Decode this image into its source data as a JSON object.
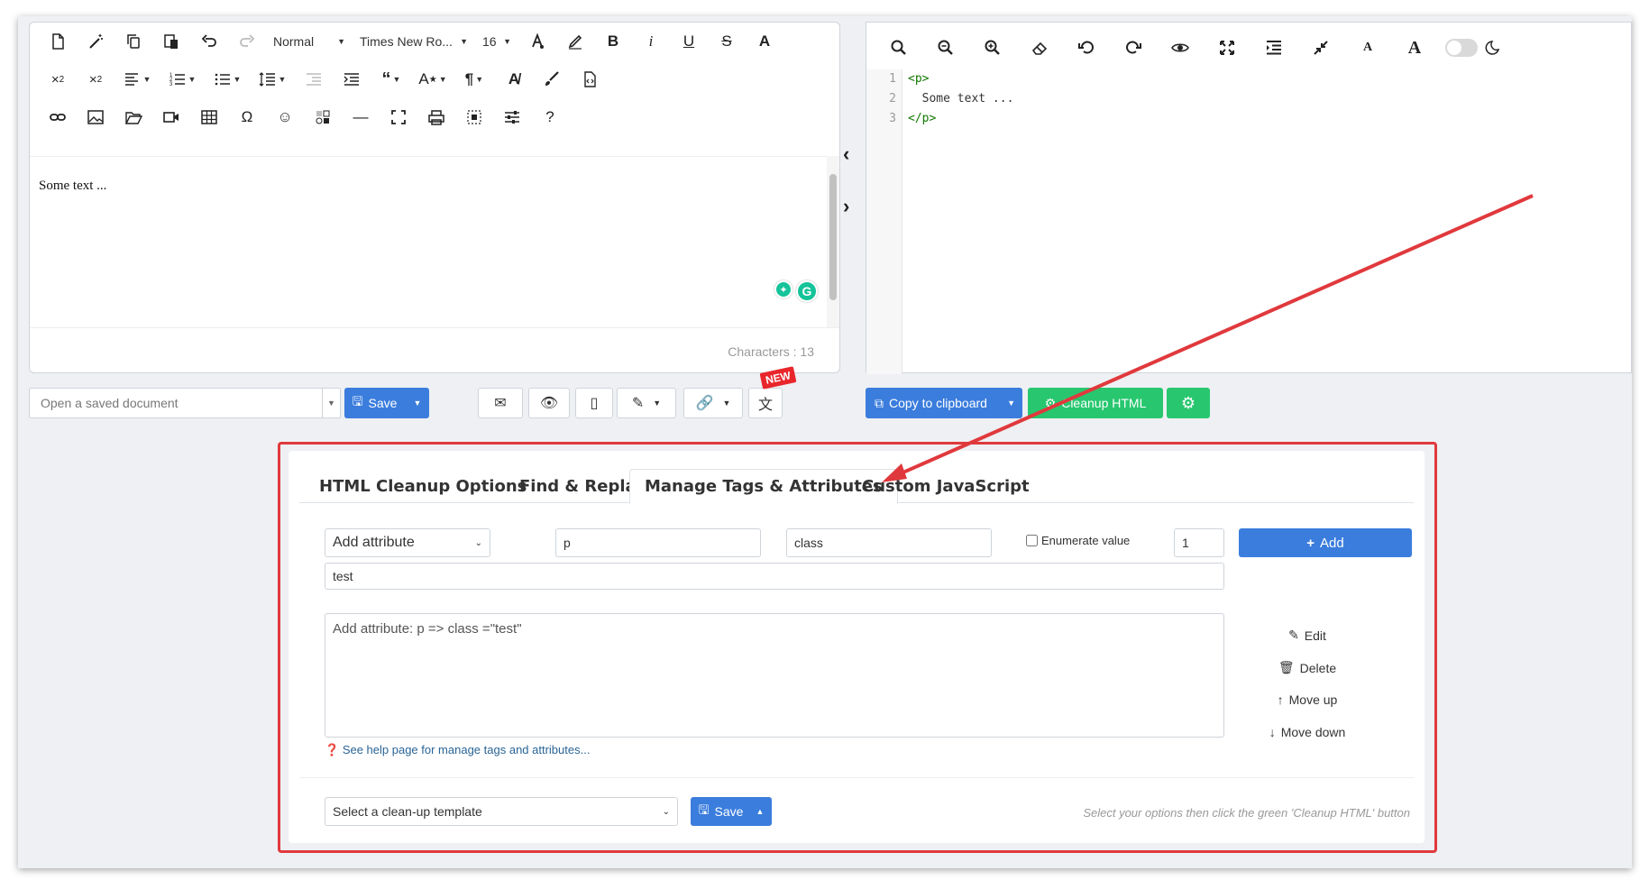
{
  "editor": {
    "toolbar": {
      "format_label": "Normal",
      "font_label": "Times New Ro...",
      "size_label": "16"
    },
    "content_text": "Some text ...",
    "characters_text": "Characters : 13"
  },
  "code_editor": {
    "line_numbers": [
      "1",
      "2",
      "3"
    ],
    "line1_tag": "<p>",
    "line2_text": "  Some text ...",
    "line3_tag": "</p>"
  },
  "action_bar": {
    "open_doc_placeholder": "Open a saved document",
    "save_label": "Save",
    "new_badge": "NEW",
    "copy_label": "Copy to clipboard",
    "cleanup_label": "Cleanup HTML"
  },
  "panel": {
    "tabs": [
      {
        "label": "HTML Cleanup Options",
        "active": false
      },
      {
        "label": "Find & Replace",
        "active": false
      },
      {
        "label": "Manage Tags & Attributes",
        "active": true
      },
      {
        "label": "Custom JavaScript",
        "active": false
      }
    ],
    "action_select": "Add attribute",
    "tag_value": "p",
    "attribute_value": "class",
    "enumerate_label": "Enumerate value",
    "enumerate_checked": false,
    "number_value": "1",
    "add_label": "Add",
    "value_text": "test",
    "rules_text": "Add attribute: p => class =\"test\"",
    "edit_label": "Edit",
    "delete_label": "Delete",
    "move_up_label": "Move up",
    "move_down_label": "Move down",
    "help_link": "See help page for manage tags and attributes...",
    "template_select": "Select a clean-up template",
    "template_save_label": "Save",
    "hint_text": "Select your options then click the green 'Cleanup HTML' button"
  },
  "colors": {
    "primary_blue": "#3b7ddd",
    "success_green": "#28c76f",
    "annotation_red": "#e0393d"
  }
}
